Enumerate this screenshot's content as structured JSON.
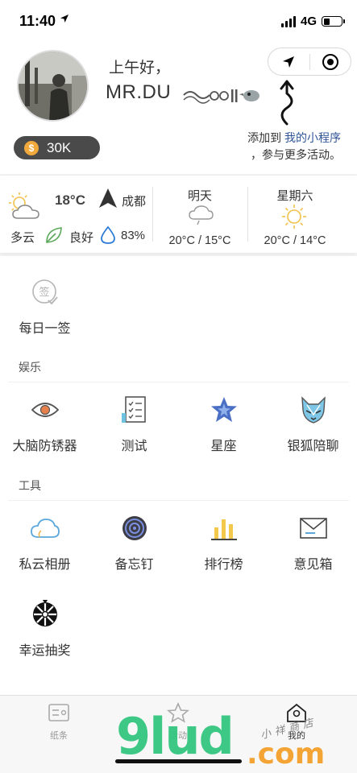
{
  "status": {
    "time": "11:40",
    "network": "4G"
  },
  "profile": {
    "greeting": "上午好，",
    "name": "MR.DU",
    "coins": "30K"
  },
  "mini_program": {
    "prefix": "添加到 ",
    "link": "我的小程序",
    "suffix": "，参与更多活动。"
  },
  "weather": {
    "today": {
      "temp": "18°C",
      "city": "成都",
      "condition": "多云",
      "air": "良好",
      "humidity": "83%"
    },
    "tomorrow": {
      "label": "明天",
      "range": "20°C / 15°C"
    },
    "saturday": {
      "label": "星期六",
      "range": "20°C / 14°C"
    }
  },
  "daily": {
    "label": "每日一签",
    "icon": "sign-in-icon"
  },
  "entertainment": {
    "title": "娱乐",
    "items": [
      {
        "label": "大脑防锈器",
        "icon": "eye-icon"
      },
      {
        "label": "测试",
        "icon": "checklist-icon"
      },
      {
        "label": "星座",
        "icon": "star-icon"
      },
      {
        "label": "银狐陪聊",
        "icon": "fox-icon"
      }
    ]
  },
  "tools": {
    "title": "工具",
    "items": [
      {
        "label": "私云相册",
        "icon": "cloud-icon"
      },
      {
        "label": "备忘钉",
        "icon": "target-icon"
      },
      {
        "label": "排行榜",
        "icon": "bar-chart-icon"
      },
      {
        "label": "意见箱",
        "icon": "mail-icon"
      },
      {
        "label": "幸运抽奖",
        "icon": "wheel-icon"
      }
    ]
  },
  "tabbar": {
    "items": [
      {
        "label": "纸条",
        "icon": "note-icon"
      },
      {
        "label": "活动",
        "icon": "star-outline-icon"
      },
      {
        "label": "我的",
        "icon": "home-icon"
      }
    ]
  },
  "watermark": {
    "main": "9lud",
    "suffix": ".com",
    "shop": "小祥商店"
  }
}
